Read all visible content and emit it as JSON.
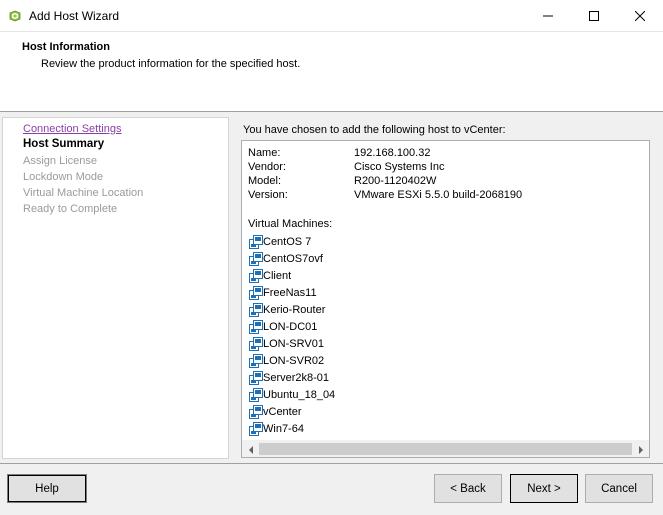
{
  "window": {
    "title": "Add Host Wizard",
    "icon": "vmware-app-icon",
    "minimize_glyph": "minimize-icon",
    "maximize_glyph": "maximize-icon",
    "close_glyph": "close-icon"
  },
  "header": {
    "title": "Host Information",
    "subtitle": "Review the product information for the specified host."
  },
  "steps": [
    {
      "label": "Connection Settings",
      "state": "link"
    },
    {
      "label": "Host Summary",
      "state": "active"
    },
    {
      "label": "Assign License",
      "state": "disabled"
    },
    {
      "label": "Lockdown Mode",
      "state": "disabled"
    },
    {
      "label": "Virtual Machine Location",
      "state": "disabled"
    },
    {
      "label": "Ready to Complete",
      "state": "disabled"
    }
  ],
  "main": {
    "intro": "You have chosen to add the following host to vCenter:",
    "info": [
      {
        "label": "Name:",
        "value": "192.168.100.32"
      },
      {
        "label": "Vendor:",
        "value": "Cisco Systems Inc"
      },
      {
        "label": "Model:",
        "value": "R200-1120402W"
      },
      {
        "label": "Version:",
        "value": "VMware ESXi 5.5.0 build-2068190"
      }
    ],
    "vm_heading": "Virtual Machines:",
    "vms": [
      "CentOS 7",
      "CentOS7ovf",
      "Client",
      "FreeNas11",
      "Kerio-Router",
      "LON-DC01",
      "LON-SRV01",
      "LON-SVR02",
      "Server2k8-01",
      "Ubuntu_18_04",
      "vCenter",
      "Win7-64"
    ],
    "vm_icon": "virtual-machine-icon"
  },
  "footer": {
    "help": "Help",
    "back": "< Back",
    "next": "Next >",
    "cancel": "Cancel"
  },
  "colors": {
    "link": "#8a3fa8",
    "disabled_text": "#9a9a9a",
    "vm_icon": "#1f6fb5",
    "accent": "#7fb800"
  }
}
